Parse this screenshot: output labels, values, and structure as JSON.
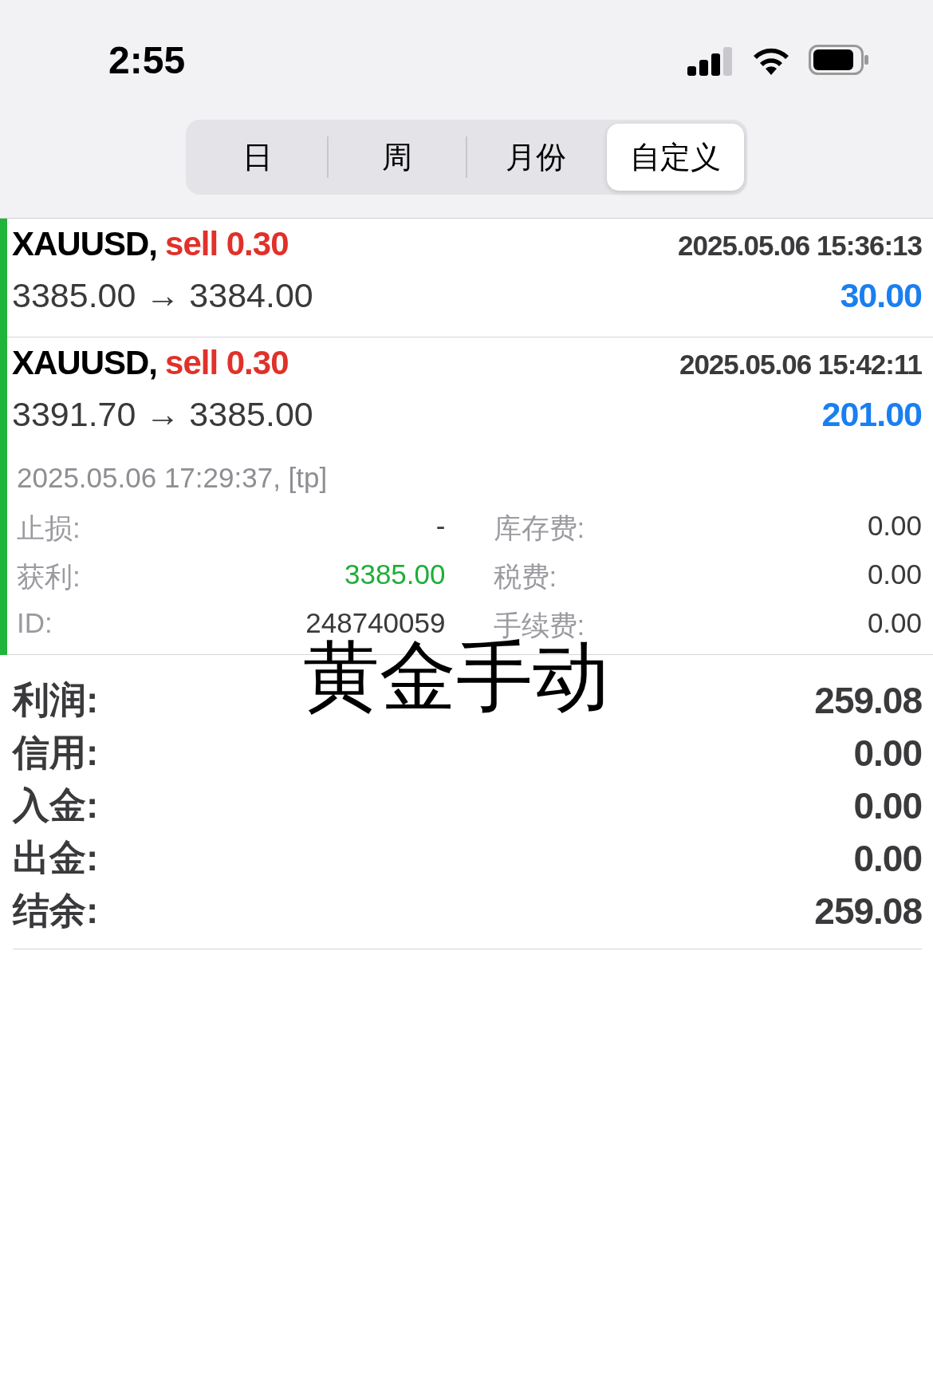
{
  "status_bar": {
    "time": "2:55"
  },
  "periods": [
    {
      "label": "日",
      "selected": false
    },
    {
      "label": "周",
      "selected": false
    },
    {
      "label": "月份",
      "selected": false
    },
    {
      "label": "自定义",
      "selected": true
    }
  ],
  "deals": [
    {
      "symbol": "XAUUSD,",
      "side": "sell 0.30",
      "open_time": "2025.05.06 15:36:13",
      "prices": "3385.00 → 3384.00",
      "profit": "30.00"
    },
    {
      "symbol": "XAUUSD,",
      "side": "sell 0.30",
      "open_time": "2025.05.06 15:42:11",
      "prices": "3391.70 → 3385.00",
      "profit": "201.00",
      "close_info": "2025.05.06 17:29:37, [tp]",
      "details": [
        {
          "label": "止损:",
          "value": "-",
          "color": "#3a3a3c"
        },
        {
          "label": "库存费:",
          "value": "0.00",
          "color": "#3a3a3c"
        },
        {
          "label": "获利:",
          "value": "3385.00",
          "color": "#1fae3a"
        },
        {
          "label": "税费:",
          "value": "0.00",
          "color": "#3a3a3c"
        },
        {
          "label": "ID:",
          "value": "248740059",
          "color": "#3a3a3c"
        },
        {
          "label": "手续费:",
          "value": "0.00",
          "color": "#3a3a3c"
        }
      ]
    }
  ],
  "caption": "黄金手动",
  "summary": [
    {
      "label": "利润:",
      "value": "259.08"
    },
    {
      "label": "信用:",
      "value": "0.00"
    },
    {
      "label": "入金:",
      "value": "0.00"
    },
    {
      "label": "出金:",
      "value": "0.00"
    },
    {
      "label": "结余:",
      "value": "259.08"
    }
  ]
}
